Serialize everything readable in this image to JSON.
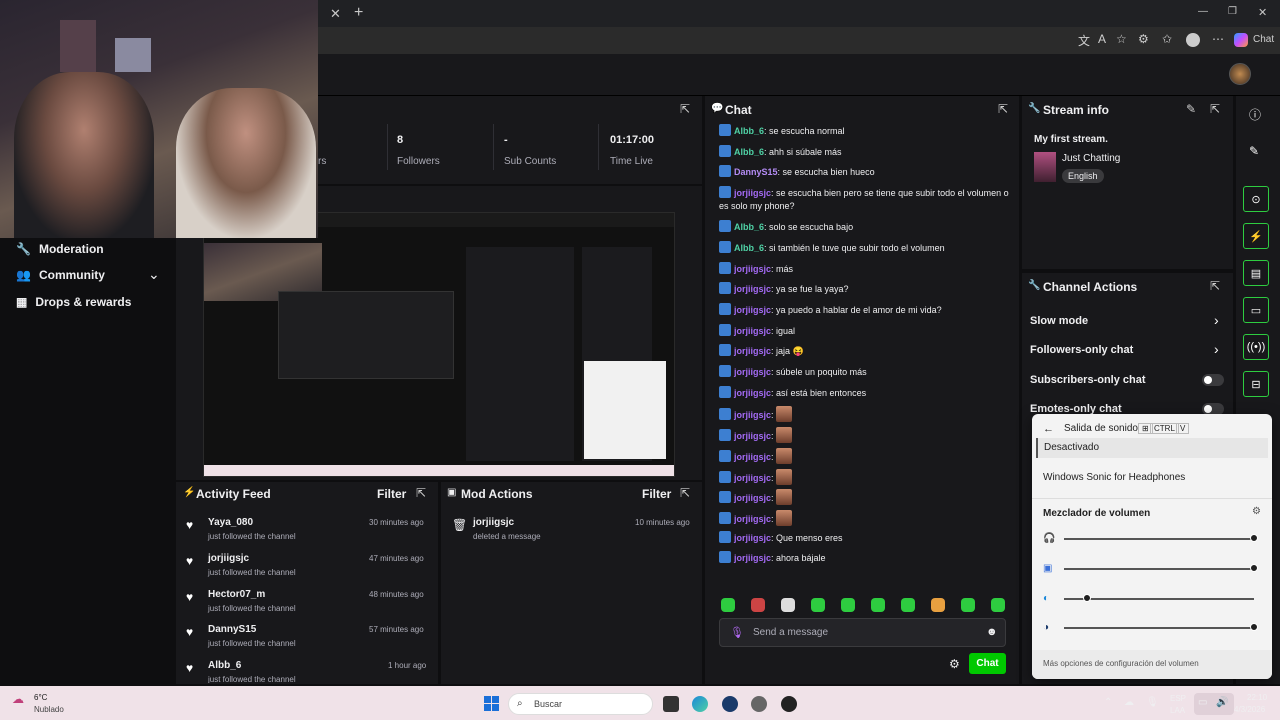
{
  "browser": {
    "close_tab": "✕",
    "new_tab": "+",
    "copilot_label": "Chat"
  },
  "sidebar": {
    "items": [
      {
        "label": "Moderation"
      },
      {
        "label": "Community"
      },
      {
        "label": "Drops & rewards"
      }
    ]
  },
  "stats": [
    {
      "value": "",
      "label": "rs"
    },
    {
      "value": "8",
      "label": "Followers"
    },
    {
      "value": "-",
      "label": "Sub Counts"
    },
    {
      "value": "01:17:00",
      "label": "Time Live"
    }
  ],
  "activity_feed": {
    "title": "Activity Feed",
    "filter_label": "Filter",
    "items": [
      {
        "name": "Yaya_080",
        "action": "just followed the channel",
        "time": "30 minutes ago"
      },
      {
        "name": "jorjiigsjc",
        "action": "just followed the channel",
        "time": "47 minutes ago"
      },
      {
        "name": "Hector07_m",
        "action": "just followed the channel",
        "time": "48 minutes ago"
      },
      {
        "name": "DannyS15",
        "action": "just followed the channel",
        "time": "57 minutes ago"
      },
      {
        "name": "Albb_6",
        "action": "just followed the channel",
        "time": "1 hour ago"
      }
    ]
  },
  "mod_actions": {
    "title": "Mod Actions",
    "filter_label": "Filter",
    "items": [
      {
        "name": "jorjiigsjc",
        "action": "deleted a message",
        "time": "10 minutes ago"
      }
    ]
  },
  "chat": {
    "title": "Chat",
    "messages": [
      {
        "user": "Albb_6",
        "color": "#4fd1a5",
        "text": ": se escucha normal"
      },
      {
        "user": "Albb_6",
        "color": "#4fd1a5",
        "text": ": ahh si súbale más"
      },
      {
        "user": "DannyS15",
        "color": "#b48cf5",
        "text": ": se escucha bien hueco"
      },
      {
        "user": "jorjiigsjc",
        "color": "#a46bf5",
        "text": ": se escucha bien pero se tiene que subir todo el volumen o es solo my phone?"
      },
      {
        "user": "Albb_6",
        "color": "#4fd1a5",
        "text": ": solo se escucha bajo"
      },
      {
        "user": "Albb_6",
        "color": "#4fd1a5",
        "text": ": si también le tuve que subir todo el volumen"
      },
      {
        "user": "jorjiigsjc",
        "color": "#a46bf5",
        "text": ": más"
      },
      {
        "user": "jorjiigsjc",
        "color": "#a46bf5",
        "text": ": ya se fue la yaya?"
      },
      {
        "user": "jorjiigsjc",
        "color": "#a46bf5",
        "text": ": ya puedo a hablar de el amor de mi vida?"
      },
      {
        "user": "jorjiigsjc",
        "color": "#a46bf5",
        "text": ": igual"
      },
      {
        "user": "jorjiigsjc",
        "color": "#a46bf5",
        "text": ": jaja 😝"
      },
      {
        "user": "jorjiigsjc",
        "color": "#a46bf5",
        "text": ": súbele un poquito más"
      },
      {
        "user": "jorjiigsjc",
        "color": "#a46bf5",
        "text": ": así está bien entonces"
      },
      {
        "user": "jorjiigsjc",
        "color": "#a46bf5",
        "text": ":",
        "emote": true
      },
      {
        "user": "jorjiigsjc",
        "color": "#a46bf5",
        "text": ":",
        "emote": true
      },
      {
        "user": "jorjiigsjc",
        "color": "#a46bf5",
        "text": ":",
        "emote": true
      },
      {
        "user": "jorjiigsjc",
        "color": "#a46bf5",
        "text": ":",
        "emote": true
      },
      {
        "user": "jorjiigsjc",
        "color": "#a46bf5",
        "text": ":",
        "emote": true
      },
      {
        "user": "jorjiigsjc",
        "color": "#a46bf5",
        "text": ":",
        "emote": true
      },
      {
        "user": "jorjiigsjc",
        "color": "#a46bf5",
        "text": ": Que menso eres"
      },
      {
        "user": "jorjiigsjc",
        "color": "#a46bf5",
        "text": ": ahora bájale"
      }
    ],
    "input_placeholder": "Send a message",
    "send_label": "Chat"
  },
  "stream_info": {
    "title": "Stream info",
    "stream_title": "My first stream.",
    "category": "Just Chatting",
    "language": "English"
  },
  "channel_actions": {
    "title": "Channel Actions",
    "items": [
      {
        "label": "Slow mode",
        "kind": "chevron"
      },
      {
        "label": "Followers-only chat",
        "kind": "chevron"
      },
      {
        "label": "Subscribers-only chat",
        "kind": "toggle"
      },
      {
        "label": "Emotes-only chat",
        "kind": "toggle"
      }
    ]
  },
  "sound_flyout": {
    "title": "Salida de sonido",
    "shortcut_keys": [
      "CTRL",
      "V"
    ],
    "options": [
      "Desactivado",
      "Windows Sonic for Headphones"
    ],
    "mixer_title": "Mezclador de volumen",
    "mixer_levels": [
      1.0,
      1.0,
      0.12,
      1.0
    ],
    "more_options": "Más opciones de configuración del volumen"
  },
  "taskbar": {
    "weather_temp": "6°C",
    "weather_desc": "Nublado",
    "search_placeholder": "Buscar",
    "lang_top": "ESP",
    "lang_bottom": "LAA",
    "time": "22:10",
    "date": "4/3/2026"
  },
  "icons": [
    "pin-icon",
    "people-icon",
    "gift-icon",
    "chevron-down-icon",
    "popout-icon",
    "heart-icon",
    "trash-icon",
    "chat-bubble-icon",
    "pencil-icon",
    "info-icon",
    "mic-icon",
    "emoji-icon",
    "gear-icon",
    "windows-icon",
    "search-icon"
  ]
}
